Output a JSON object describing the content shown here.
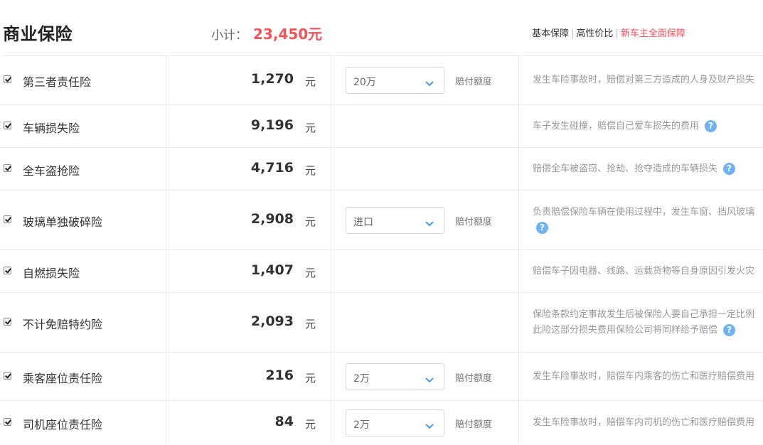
{
  "header": {
    "title": "商业保险",
    "subtotal_label": "小计：",
    "subtotal_amount": "23,450元",
    "plans": [
      "基本保障",
      "高性价比",
      "新车主全面保障"
    ]
  },
  "unit": "元",
  "limit_label": "赔付额度",
  "help_icon": "?",
  "colors": {
    "accent": "#f2525a",
    "help": "#6fb3f3"
  },
  "rows": [
    {
      "name": "第三者责任险",
      "price": "1,270",
      "select": "20万",
      "desc": [
        "发生车险事故时，赔偿对第三方造成的人身及财产损失"
      ]
    },
    {
      "name": "车辆损失险",
      "price": "9,196",
      "desc": [
        "车子发生碰撞，赔偿自己爱车损失的费用"
      ]
    },
    {
      "name": "全车盗抢险",
      "price": "4,716",
      "desc": [
        "赔偿全车被盗窃、抢劫、抢夺造成的车辆损失"
      ]
    },
    {
      "name": "玻璃单独破碎险",
      "price": "2,908",
      "select": "进口",
      "desc": [
        "负责赔偿保险车辆在使用过程中，发生车窗、挡风玻璃"
      ]
    },
    {
      "name": "自燃损失险",
      "price": "1,407",
      "desc": [
        "赔偿车子因电器、线路、运载货物等自身原因引发火灾"
      ]
    },
    {
      "name": "不计免赔特约险",
      "price": "2,093",
      "desc": [
        "保险条款约定事故发生后被保险人要自己承担一定比例",
        "此险这部分损失费用保险公司将同样给予赔偿"
      ]
    },
    {
      "name": "乘客座位责任险",
      "price": "216",
      "select": "2万",
      "desc": [
        "发生车险事故时，赔偿车内乘客的伤亡和医疗赔偿费用"
      ]
    },
    {
      "name": "司机座位责任险",
      "price": "84",
      "select": "2万",
      "desc": [
        "发生车险事故时，赔偿车内司机的伤亡和医疗赔偿费用"
      ]
    }
  ]
}
